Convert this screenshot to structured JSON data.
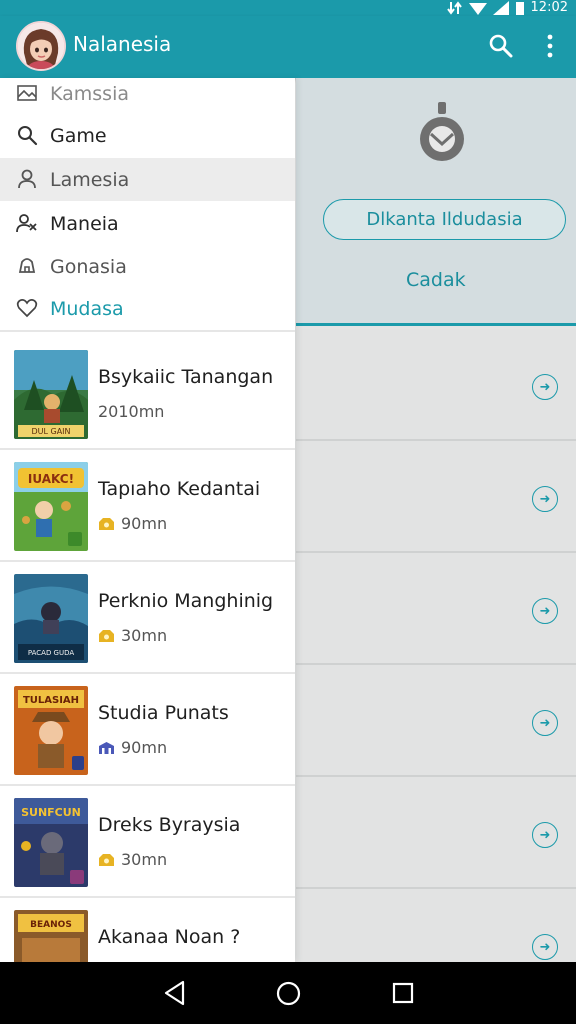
{
  "status_bar": {
    "time": "12:02"
  },
  "app_bar": {
    "title": "Nalanesia"
  },
  "drawer": {
    "menu": [
      {
        "label": "Kamssia",
        "icon": "image-icon"
      },
      {
        "label": "Game",
        "icon": "search-icon"
      },
      {
        "label": "Lamesia",
        "icon": "person-icon"
      },
      {
        "label": "Maneia",
        "icon": "people-icon"
      },
      {
        "label": "Gonasia",
        "icon": "bell-icon"
      },
      {
        "label": "Mudasa",
        "icon": "heart-icon"
      }
    ],
    "selected_index": 2
  },
  "games": [
    {
      "title": "Bsykaiic Tanangan",
      "meta": "2010mn",
      "badge": "none",
      "thumb_text": "DUL GAIN"
    },
    {
      "title": "Tapıaho Kedantai",
      "meta": "90mn",
      "badge": "gold",
      "thumb_text": "IUAKC!"
    },
    {
      "title": "Perknio Manghinig",
      "meta": "30mn",
      "badge": "gold",
      "thumb_text": "PACAD GUDA"
    },
    {
      "title": "Studia Punats",
      "meta": "90mn",
      "badge": "blue",
      "thumb_text": "TULASIAH"
    },
    {
      "title": "Dreks Byraysia",
      "meta": "30mn",
      "badge": "gold",
      "thumb_text": "SUNFCUN"
    },
    {
      "title": "Akanaa Noan ?",
      "meta": "",
      "badge": "none",
      "thumb_text": "BEANOS"
    }
  ],
  "right_panel": {
    "primary_button": "Dlkanta Ildudasia",
    "secondary_button": "Cadak"
  },
  "colors": {
    "accent": "#1b9aaa",
    "accent_text": "#1b8e9d"
  }
}
